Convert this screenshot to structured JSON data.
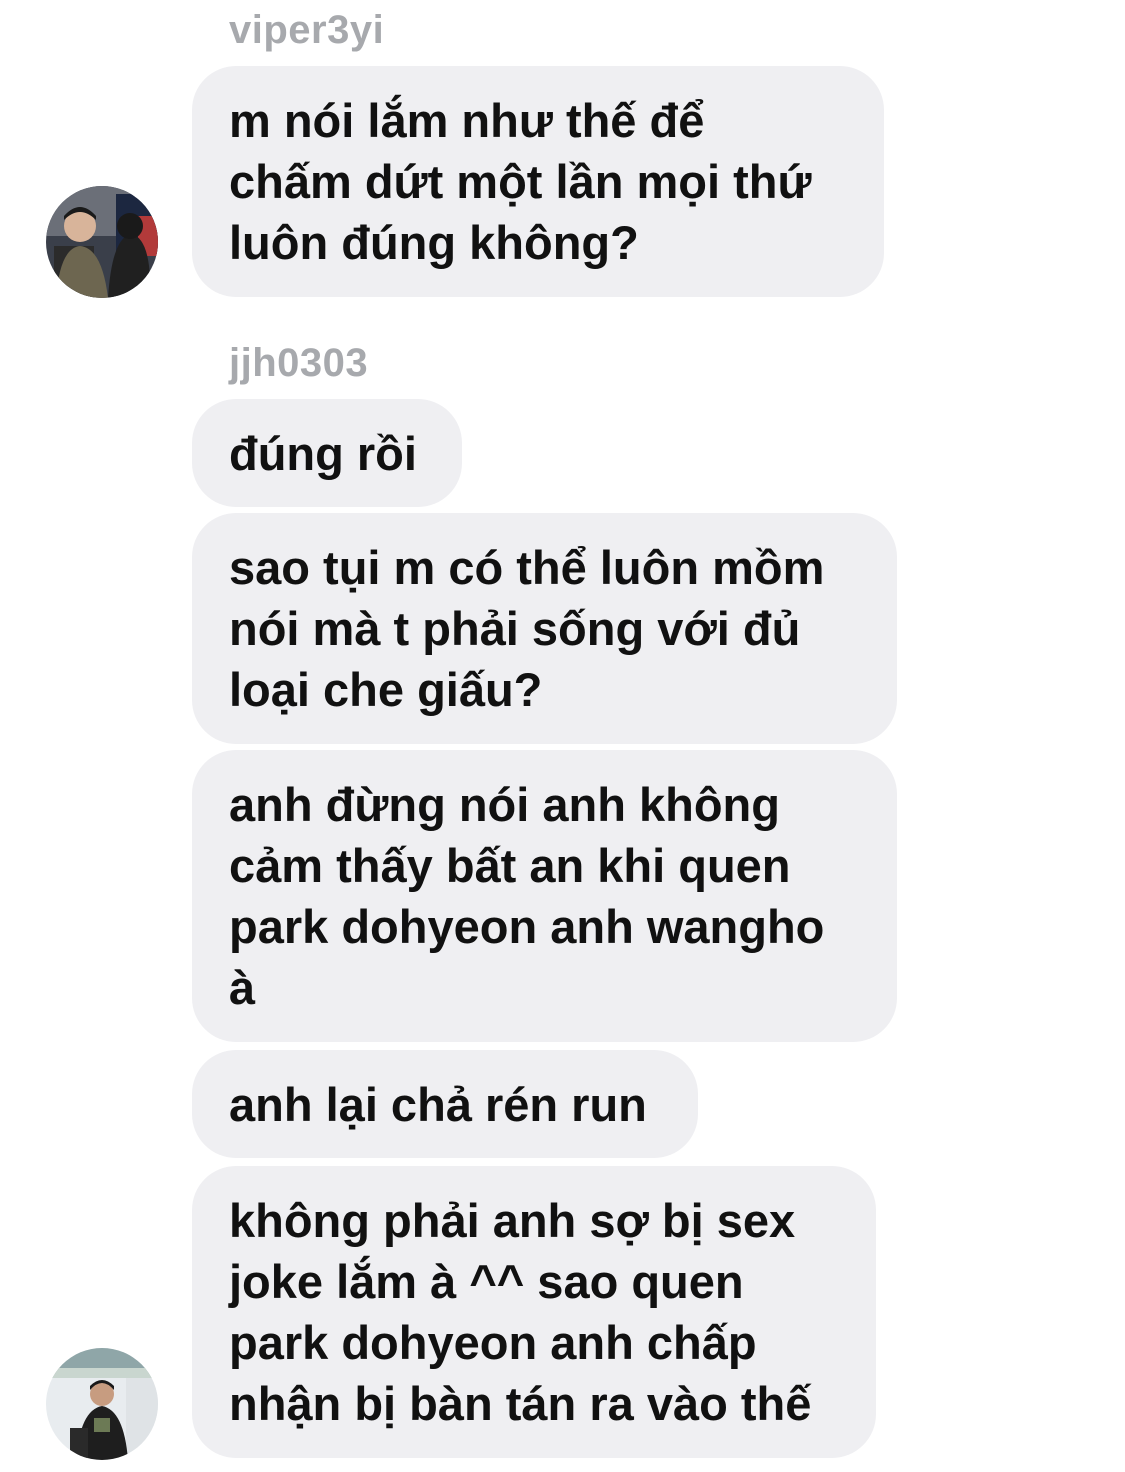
{
  "thread": {
    "groups": [
      {
        "sender": "viper3yi",
        "messages": [
          "m nói lắm như thế để\nchấm dứt một lần mọi thứ\nluôn đúng không?"
        ]
      },
      {
        "sender": "jjh0303",
        "messages": [
          "đúng rồi",
          "sao tụi m có thể luôn mồm\nnói mà t phải sống với đủ\nloại che giấu?",
          "anh đừng nói anh không\ncảm thấy bất an khi quen\npark dohyeon anh wangho\nà",
          "anh lại chả rén run",
          "không phải anh sợ bị sex\njoke lắm à ^^ sao quen\npark dohyeon anh chấp\nnhận bị bàn tán ra vào thế"
        ]
      }
    ]
  },
  "colors": {
    "bubble": "#efeff2",
    "sender_name": "#a7a9ad",
    "text": "#111111"
  },
  "icons": {
    "avatar_1": "profile-photo-avatar",
    "avatar_2": "profile-photo-avatar"
  }
}
